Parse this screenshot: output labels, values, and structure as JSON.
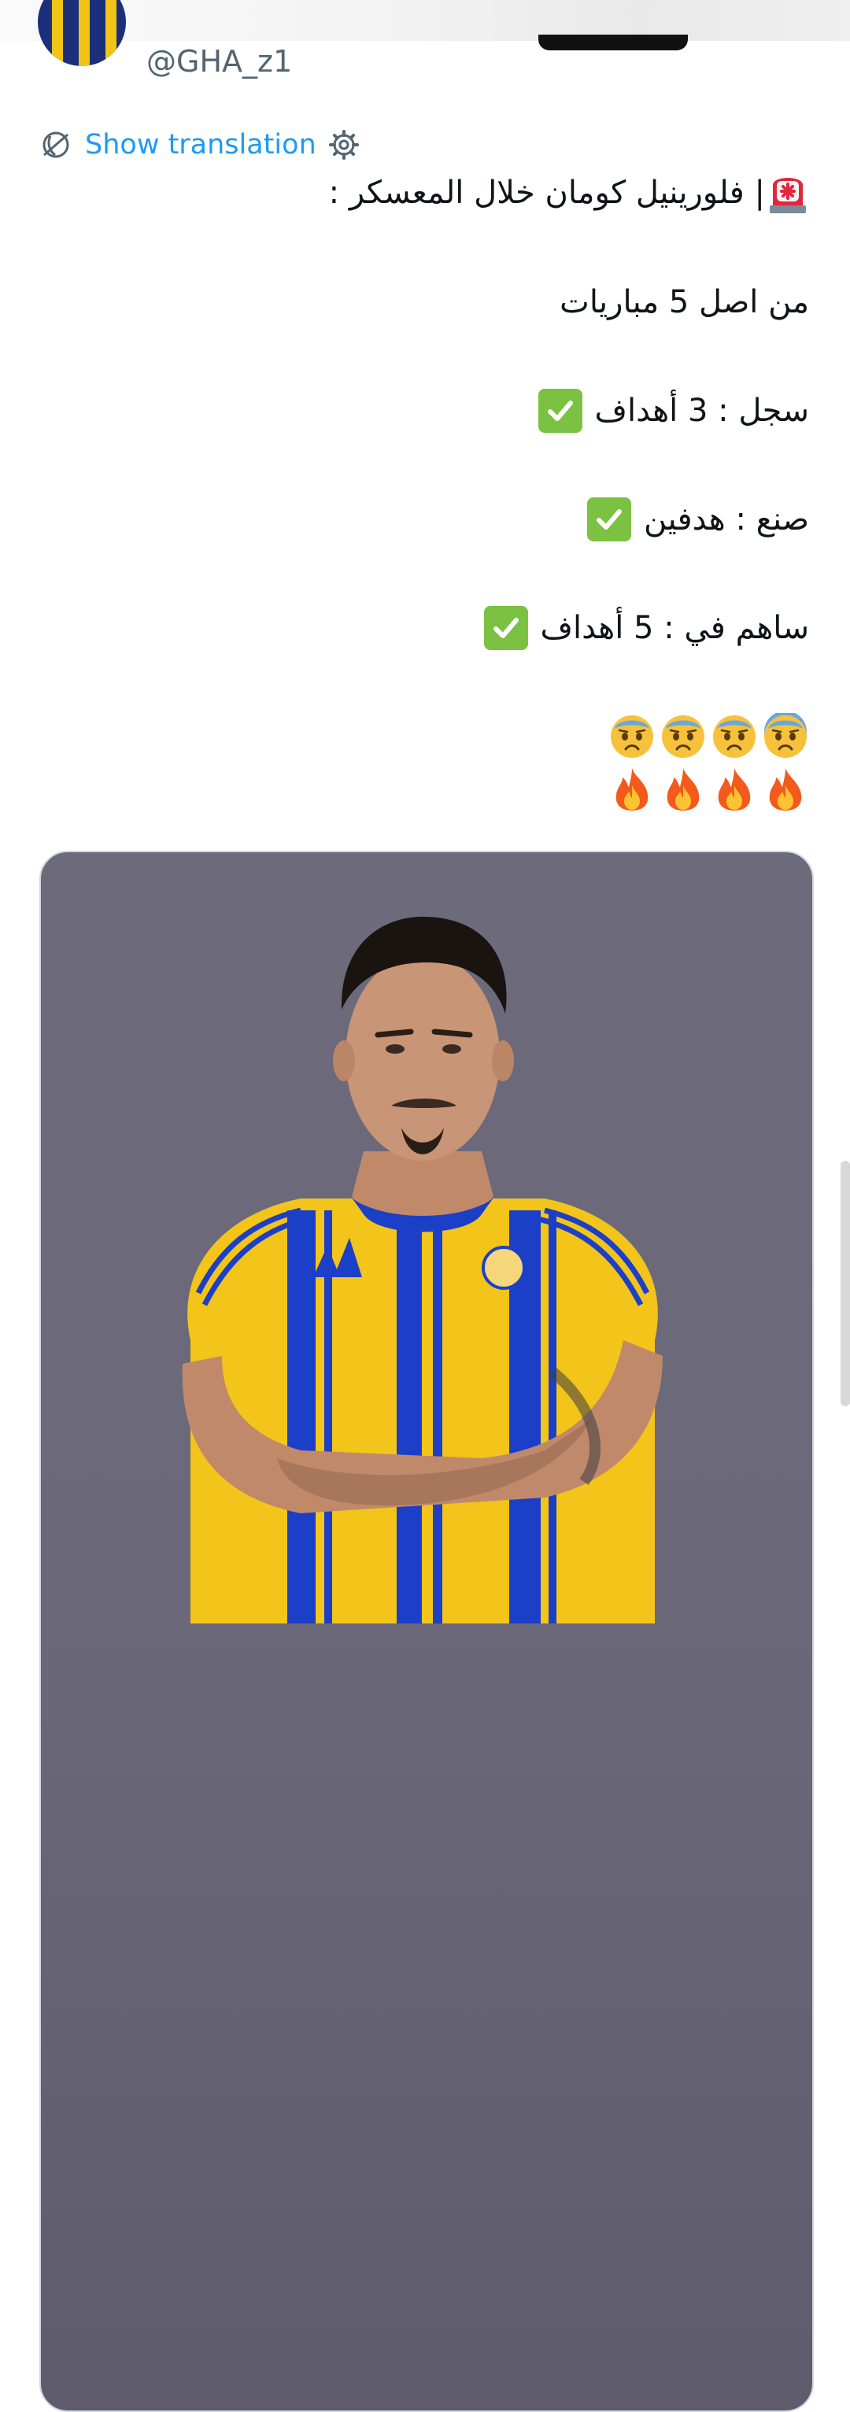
{
  "author": {
    "handle": "@GHA_z1"
  },
  "translation": {
    "label": "Show translation"
  },
  "tweet": {
    "headline": "| فلورينيل كومان خلال المعسكر :",
    "line_matches": "من اصل 5 مباريات",
    "line_scored": "سجل : 3 أهداف",
    "line_assisted": "صنع : هدفين",
    "line_contributed": "ساهم في : 5 أهداف",
    "emoji_row_faces": [
      "worried-face-icon",
      "worried-face-icon",
      "worried-face-icon",
      "worried-face-icon"
    ],
    "emoji_row_fire": [
      "fire-icon",
      "fire-icon",
      "fire-icon",
      "fire-icon"
    ]
  },
  "colors": {
    "link": "#1d9bf0",
    "handle": "#536471",
    "check": "#7bc142",
    "kit_yellow": "#f3c41a",
    "kit_blue": "#1c3fc8",
    "photo_background": "#6b6979"
  }
}
